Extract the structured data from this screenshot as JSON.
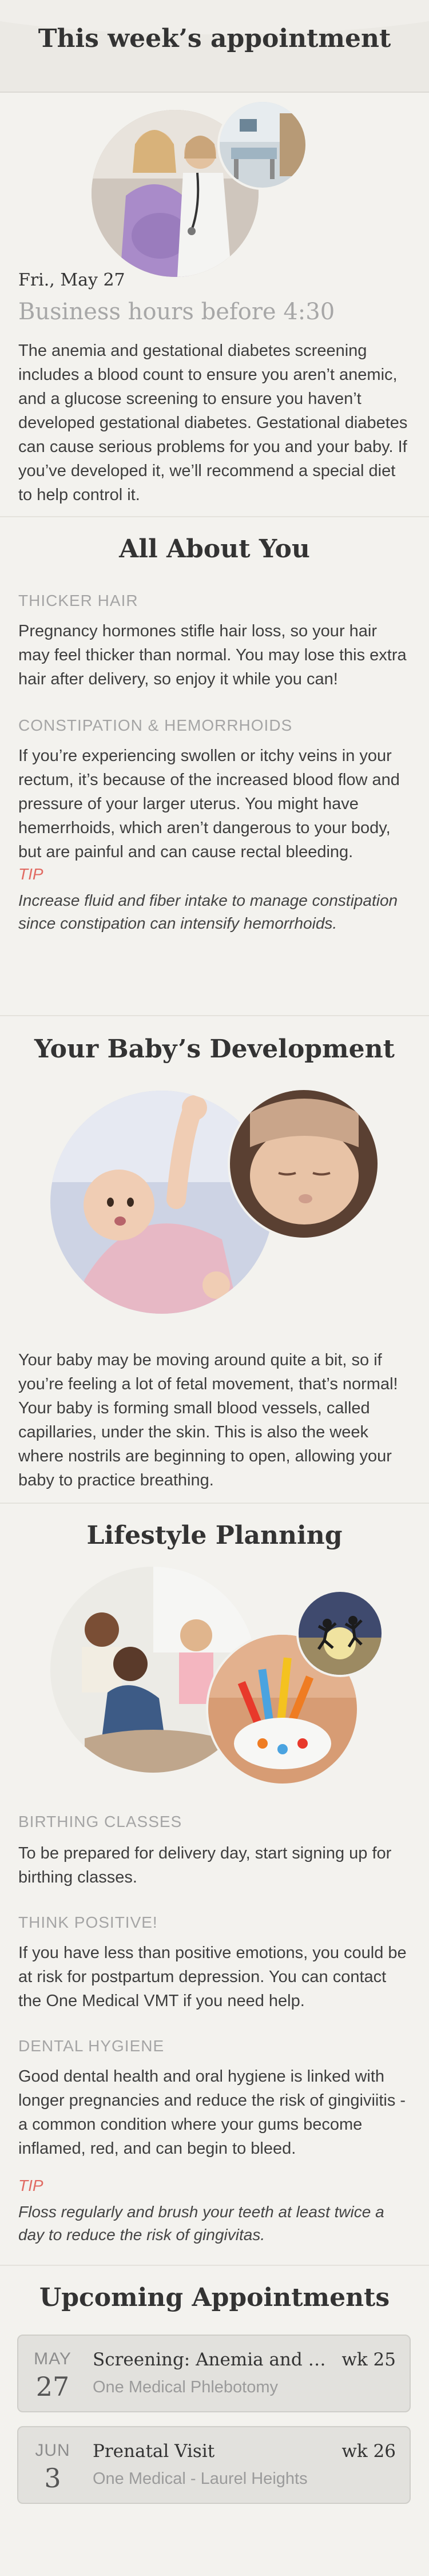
{
  "header": {
    "title": "This week’s appointment"
  },
  "appointment": {
    "date": "Fri., May 27",
    "hours": "Business hours before 4:30",
    "description": "The anemia and gestational diabetes screening includes a blood count to ensure you aren’t anemic, and a glucose screening to ensure you haven’t developed gestational diabetes. Gestational diabetes can cause serious problems for you and your baby. If you’ve developed it, we’ll recommend a special diet to help control it."
  },
  "about": {
    "title": "All About You",
    "items": [
      {
        "heading": "THICKER HAIR",
        "text": "Pregnancy hormones stifle hair loss, so your hair may feel thicker than normal. You may lose this extra hair after delivery, so enjoy it while you can!"
      },
      {
        "heading": "CONSTIPATION & HEMORRHOIDS",
        "text": "If you’re experiencing swollen or itchy veins in your rectum, it’s because of the increased blood flow and pressure of your larger uterus. You might have hemerrhoids, which aren’t dangerous to your body, but are painful and can cause rectal bleeding."
      }
    ],
    "tip_label": "TIP",
    "tip_text": "Increase fluid and fiber intake to manage constipation since constipation can intensify hemorrhoids."
  },
  "baby": {
    "title": "Your Baby’s Development",
    "text": "Your baby may be moving around quite a bit, so if you’re feeling a lot of fetal movement, that’s normal! Your baby is forming small blood vessels, called capillaries, under the skin. This is also the week where nostrils are beginning to open, allowing your baby to practice breathing."
  },
  "lifestyle": {
    "title": "Lifestyle Planning",
    "items": [
      {
        "heading": "BIRTHING CLASSES",
        "text": "To be prepared for delivery day, start signing up for birthing classes."
      },
      {
        "heading": "THINK POSITIVE!",
        "text": "If you have less than positive emotions, you could be at risk for postpartum depression. You can contact the One Medical VMT if you need help."
      },
      {
        "heading": "DENTAL HYGIENE",
        "text": "Good dental health and oral hygiene is linked with longer pregnancies and reduce the risk of gingiviitis - a common condition where your gums become inflamed, red, and can begin to bleed."
      }
    ],
    "tip_label": "TIP",
    "tip_text": "Floss regularly and brush your teeth at least twice a day to reduce the risk of gingivitas."
  },
  "upcoming": {
    "title": "Upcoming Appointments",
    "cards": [
      {
        "month": "MAY",
        "day": "27",
        "title": "Screening: Anemia and gestational diabetes",
        "location": "One Medical Phlebotomy",
        "week": "wk 25"
      },
      {
        "month": "JUN",
        "day": "3",
        "title": "Prenatal Visit",
        "location": "One Medical - Laurel Heights",
        "week": "wk 26"
      }
    ]
  },
  "colors": {
    "background": "#f3f2ee",
    "tip": "#e16a62",
    "subheading": "#a5a5a5",
    "card": "#e2e1dd"
  },
  "icons": [
    "photo-mother-doctor",
    "photo-exam-room",
    "photo-baby-waving",
    "photo-baby-sleeping",
    "photo-birthing-class",
    "photo-toothbrushes",
    "photo-jumping-silhouettes"
  ]
}
